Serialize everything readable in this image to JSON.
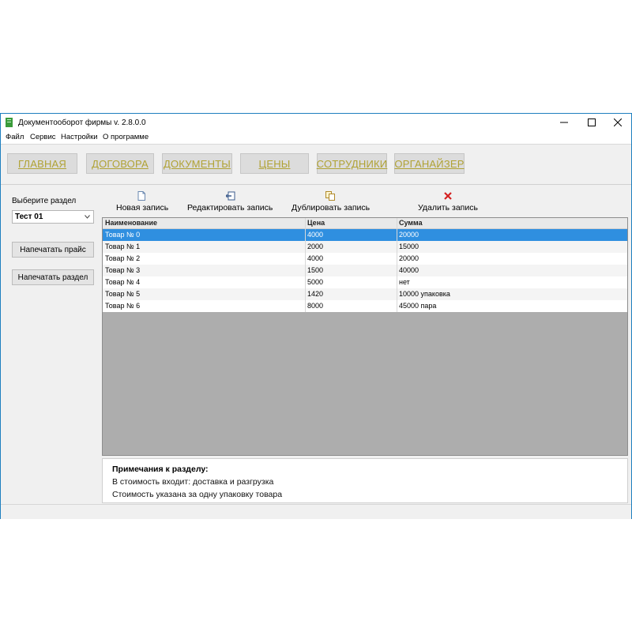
{
  "window": {
    "title": "Документооборот фирмы v. 2.8.0.0"
  },
  "menu": [
    "Файл",
    "Сервис",
    "Настройки",
    "О программе"
  ],
  "nav": [
    "ГЛАВНАЯ",
    "ДОГОВОРА",
    "ДОКУМЕНТЫ",
    "ЦЕНЫ",
    "СОТРУДНИКИ",
    "ОРГАНАЙЗЕР"
  ],
  "left_panel": {
    "section_label": "Выберите раздел",
    "selected_section": "Тест 01",
    "print_price_button": "Напечатать прайс",
    "print_section_button": "Напечатать раздел"
  },
  "toolbar": {
    "new_record": "Новая запись",
    "edit_record": "Редактировать запись",
    "duplicate_record": "Дублировать запись",
    "delete_record": "Удалить запись"
  },
  "table": {
    "columns": [
      "Наименование",
      "Цена",
      "Сумма"
    ],
    "rows": [
      [
        "Товар № 0",
        "4000",
        "20000"
      ],
      [
        "Товар № 1",
        "2000",
        "15000"
      ],
      [
        "Товар № 2",
        "4000",
        "20000"
      ],
      [
        "Товар № 3",
        "1500",
        "40000"
      ],
      [
        "Товар № 4",
        "5000",
        "нет"
      ],
      [
        "Товар № 5",
        "1420",
        "10000 упаковка"
      ],
      [
        "Товар № 6",
        "8000",
        "45000 пара"
      ]
    ],
    "selected_row": 0
  },
  "notes": {
    "title": "Примечания к разделу:",
    "lines": [
      "В стоимость входит: доставка и разгрузка",
      "Стоимость указана за одну упаковку товара"
    ]
  },
  "colors": {
    "accent": "#2f8fe0",
    "nav_text": "#b0a234",
    "window_border": "#1e7fbf",
    "delete_icon": "#d42020"
  }
}
